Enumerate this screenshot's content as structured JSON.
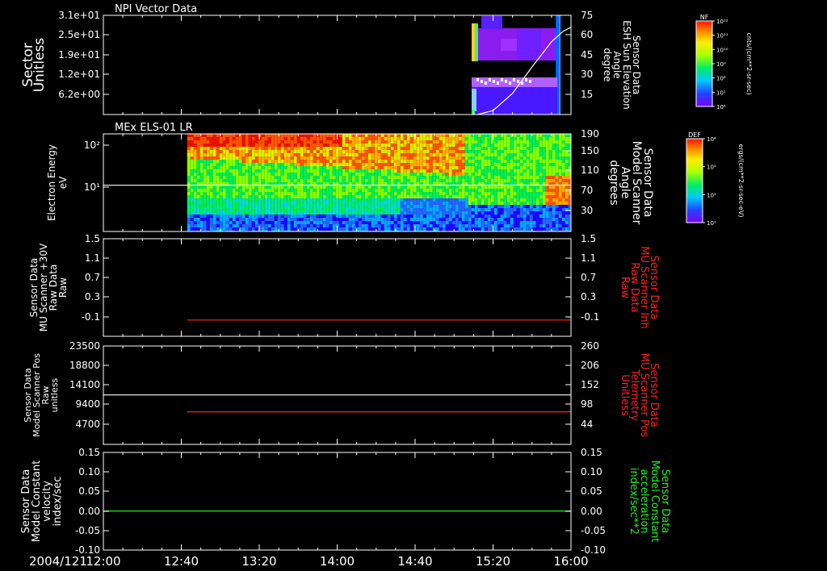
{
  "time_axis": {
    "date_label": "2004/121",
    "ticks": [
      "12:00",
      "12:40",
      "13:20",
      "14:00",
      "14:40",
      "15:20",
      "16:00"
    ],
    "range": [
      "12:00",
      "16:00"
    ]
  },
  "colors": {
    "background": "#000000",
    "axis": "#ffffff",
    "red_series": "#ff2020",
    "green_series": "#22ee22",
    "white_series": "#ffffff"
  },
  "chart_data": [
    {
      "type": "heatmap",
      "title": "NPI Vector Data",
      "ylabel_left": [
        "Sector",
        "Unitless"
      ],
      "left_ticks": [
        "3.1e+01",
        "2.5e+01",
        "1.9e+01",
        "1.2e+01",
        "6.2e+00"
      ],
      "ylabel_right": [
        "Sensor Data",
        "ESH Sun Elevation",
        "Angle",
        "degree"
      ],
      "right_ticks": [
        "75",
        "60",
        "45",
        "30",
        "15"
      ],
      "right_ylim": [
        0,
        75
      ],
      "colorbar": {
        "label": "NF",
        "unit": "cnts/(cm**2-sr-sec)",
        "ticks": [
          "10¹²",
          "10¹¹",
          "10¹⁰",
          "10⁹",
          "10⁸",
          "10⁷",
          "10⁶"
        ]
      },
      "line_series": {
        "color": "white",
        "x": [
          "15:12",
          "15:20",
          "15:30",
          "15:40",
          "15:50",
          "15:56",
          "16:00"
        ],
        "y": [
          0,
          3,
          16,
          36,
          55,
          63,
          66
        ]
      }
    },
    {
      "type": "heatmap",
      "title": "MEx ELS-01 LR",
      "ylabel_left": [
        "Electron Energy",
        "eV"
      ],
      "left_ticks": [
        "10²",
        "10¹"
      ],
      "ylabel_right": [
        "Sensor Data",
        "Model Scanner",
        "Angle",
        "degrees"
      ],
      "right_ticks": [
        "190",
        "150",
        "110",
        "70",
        "30"
      ],
      "right_ylim": [
        0,
        190
      ],
      "colorbar": {
        "label": "DEF",
        "unit": "ergs/(cm**2-sr-sec-eV)",
        "ticks": [
          "10⁴",
          "10³",
          "10²",
          "10¹"
        ]
      },
      "line_series": {
        "color": "white",
        "x": [
          "12:00",
          "16:00"
        ],
        "y": [
          90,
          90
        ]
      }
    },
    {
      "type": "line",
      "ylabel_left": [
        "Sensor Data",
        "MU Scanner +30V",
        "Raw Data",
        "Raw"
      ],
      "ylim_left": [
        -0.3,
        1.5
      ],
      "left_ticks": [
        "1.5",
        "1.1",
        "0.7",
        "0.3",
        "-0.1"
      ],
      "ylabel_right": [
        "Sensor Data",
        "MU Scanner Inh",
        "Raw Data",
        "Raw"
      ],
      "right_ticks": [
        "1.5",
        "1.1",
        "0.7",
        "0.3",
        "-0.1"
      ],
      "series": [
        {
          "color": "red",
          "x": [
            "12:43",
            "16:00"
          ],
          "y": [
            0.0,
            0.0
          ]
        }
      ]
    },
    {
      "type": "line",
      "ylabel_left": [
        "Sensor Data",
        "Model Scanner Pos",
        "Raw",
        "unitless"
      ],
      "ylim_left": [
        0,
        23500
      ],
      "left_ticks": [
        "23500",
        "18800",
        "14100",
        "9400",
        "4700"
      ],
      "ylabel_right": [
        "Sensor Data",
        "MU Scanner Pos",
        "Telemetry",
        "Unitless"
      ],
      "ylim_right": [
        0,
        260
      ],
      "right_ticks": [
        "260",
        "206",
        "152",
        "98",
        "44"
      ],
      "series": [
        {
          "color": "white",
          "axis": "left",
          "x": [
            "12:00",
            "16:00"
          ],
          "y": [
            11800,
            11800
          ]
        },
        {
          "color": "red",
          "axis": "right",
          "x": [
            "12:43",
            "16:00"
          ],
          "y": [
            86,
            86
          ]
        }
      ]
    },
    {
      "type": "line",
      "ylabel_left": [
        "Sensor Data",
        "Model Constant",
        "velocity",
        "index/sec"
      ],
      "ylim_left": [
        -0.1,
        0.15
      ],
      "left_ticks": [
        "0.15",
        "0.10",
        "0.05",
        "0.00",
        "-0.05",
        "-0.10"
      ],
      "ylabel_right": [
        "Sensor Data",
        "Model Constant",
        "acceleration",
        "index/sec**2"
      ],
      "right_ticks": [
        "0.15",
        "0.10",
        "0.05",
        "0.00",
        "-0.05",
        "-0.10"
      ],
      "series": [
        {
          "color": "green",
          "x": [
            "12:00",
            "16:00"
          ],
          "y": [
            0.0,
            0.0
          ]
        }
      ]
    }
  ]
}
